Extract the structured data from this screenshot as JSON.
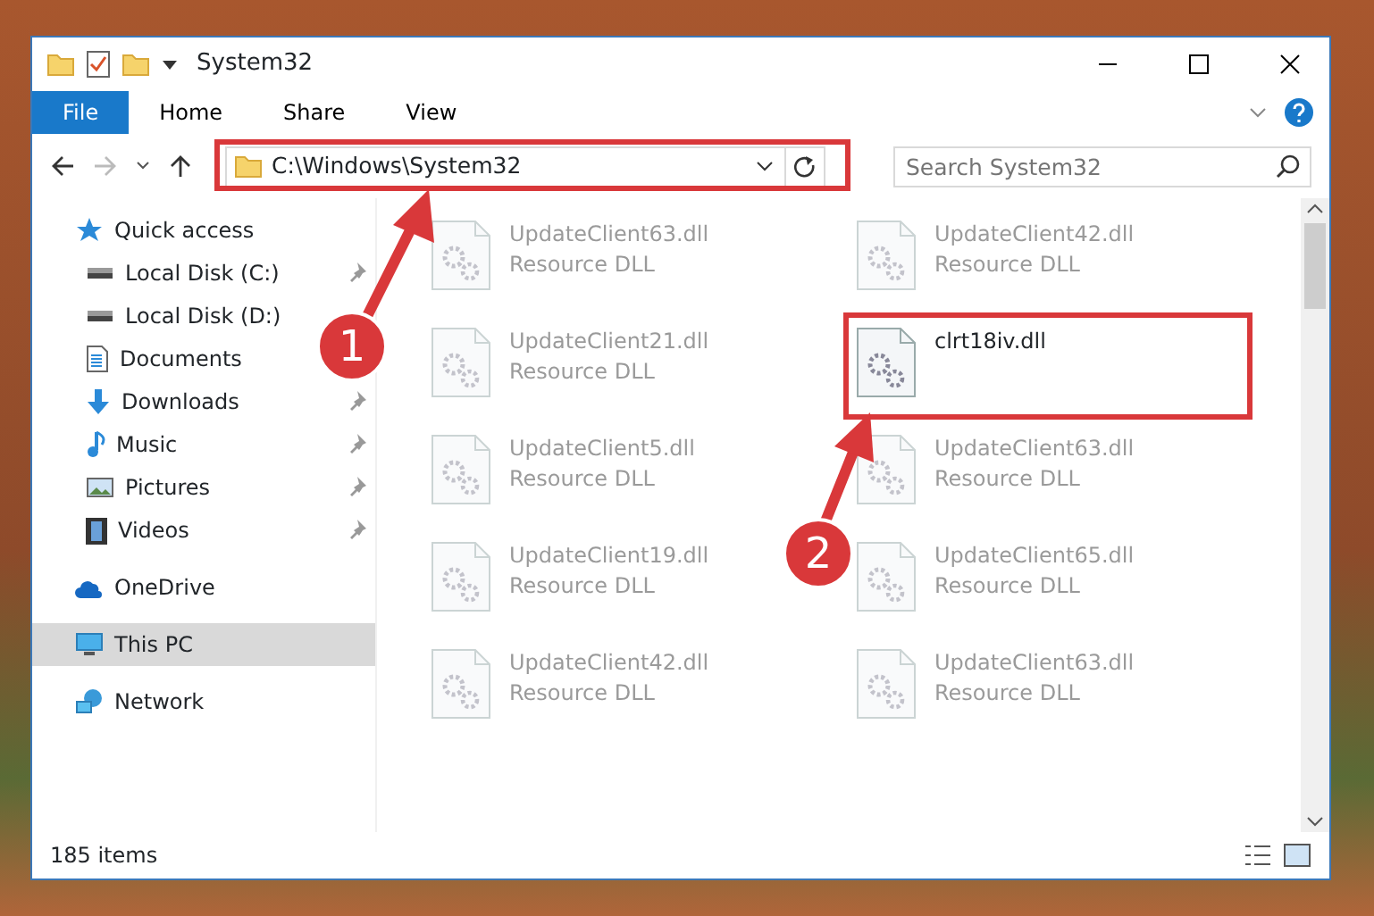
{
  "window": {
    "title": "System32"
  },
  "ribbon_tabs": [
    {
      "label": "File",
      "kind": "file"
    },
    {
      "label": "Home",
      "kind": "tab"
    },
    {
      "label": "Share",
      "kind": "tab"
    },
    {
      "label": "View",
      "kind": "tab"
    }
  ],
  "address": {
    "path": "C:\\Windows\\System32"
  },
  "search": {
    "placeholder": "Search System32"
  },
  "nav": [
    {
      "label": "Quick access",
      "kind": "star",
      "selected": false,
      "children": [
        {
          "label": "Local Disk (C:)",
          "kind": "drive",
          "pinned": true
        },
        {
          "label": "Local Disk (D:)",
          "kind": "drive",
          "pinned": false
        },
        {
          "label": "Documents",
          "kind": "document",
          "pinned": false
        },
        {
          "label": "Downloads",
          "kind": "download",
          "pinned": true
        },
        {
          "label": "Music",
          "kind": "music",
          "pinned": true
        },
        {
          "label": "Pictures",
          "kind": "picture",
          "pinned": true
        },
        {
          "label": "Videos",
          "kind": "video",
          "pinned": true
        }
      ]
    },
    {
      "label": "OneDrive",
      "kind": "cloud",
      "selected": false
    },
    {
      "label": "This PC",
      "kind": "pc",
      "selected": true
    },
    {
      "label": "Network",
      "kind": "network",
      "selected": false
    }
  ],
  "files": [
    {
      "name": "UpdateClient63.dll",
      "type": "Resource DLL",
      "dimmed": true
    },
    {
      "name": "UpdateClient42.dll",
      "type": "Resource DLL",
      "dimmed": true
    },
    {
      "name": "UpdateClient21.dll",
      "type": "Resource DLL",
      "dimmed": true
    },
    {
      "name": "clrt18iv.dll",
      "dimmed": false
    },
    {
      "name": "UpdateClient5.dll",
      "type": "Resource DLL",
      "dimmed": true
    },
    {
      "name": "UpdateClient63.dll",
      "type": "Resource DLL",
      "dimmed": true
    },
    {
      "name": "UpdateClient19.dll",
      "type": "Resource DLL",
      "dimmed": true
    },
    {
      "name": "UpdateClient65.dll",
      "type": "Resource DLL",
      "dimmed": true
    },
    {
      "name": "UpdateClient42.dll",
      "type": "Resource DLL",
      "dimmed": true
    },
    {
      "name": "UpdateClient63.dll",
      "type": "Resource DLL",
      "dimmed": true
    }
  ],
  "status_bar": {
    "count": "185 items"
  },
  "annotations": [
    {
      "number": "1"
    },
    {
      "number": "2"
    }
  ]
}
